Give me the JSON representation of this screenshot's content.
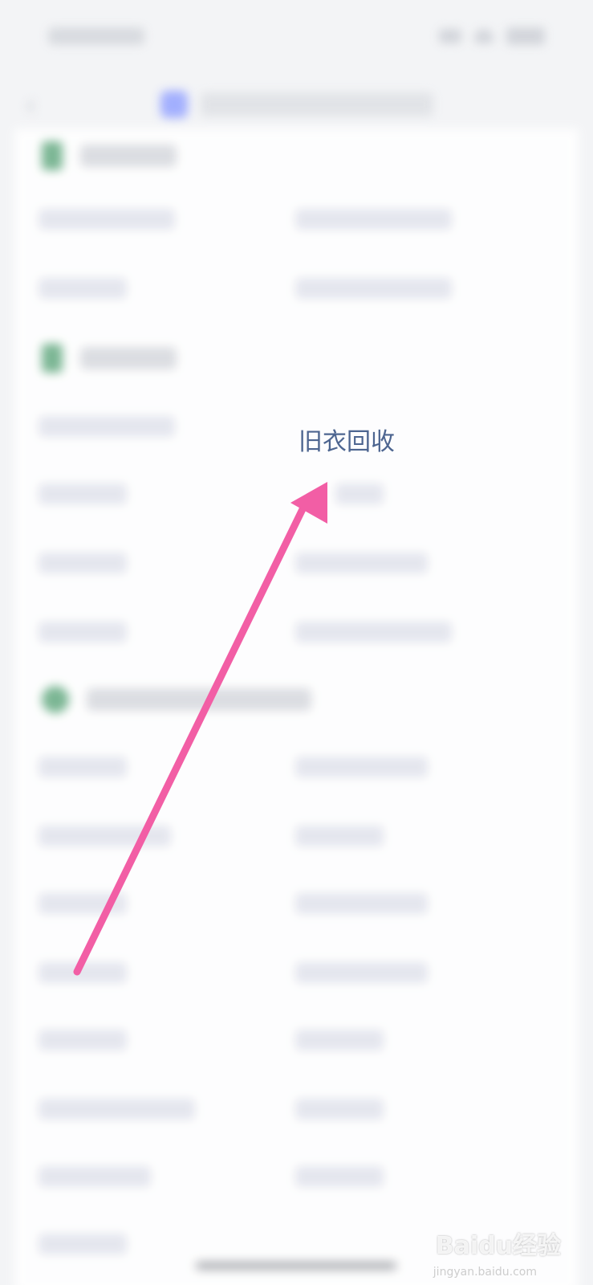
{
  "focused_item": {
    "label": "旧衣回收"
  },
  "colors": {
    "focused_text": "#4d6590",
    "arrow": "#f25ea5",
    "background": "#f3f4f6",
    "card": "#ffffff"
  },
  "watermark": {
    "main": "Baidu经验",
    "sub": "jingyan.baidu.com"
  }
}
